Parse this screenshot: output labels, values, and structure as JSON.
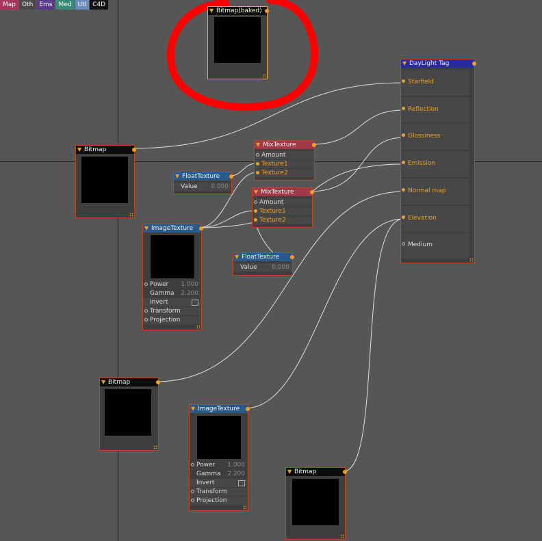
{
  "toolbar": {
    "tabs": [
      {
        "label": "Map",
        "color": "#a8365c"
      },
      {
        "label": "Oth",
        "color": "#4a4a4a"
      },
      {
        "label": "Ems",
        "color": "#5a3a8a"
      },
      {
        "label": "Med",
        "color": "#3a8a7a"
      },
      {
        "label": "Utl",
        "color": "#6a8ac0"
      },
      {
        "label": "C4D",
        "color": "#111111"
      }
    ]
  },
  "colors": {
    "bitmap_header": "#0c0c0c",
    "float_header": "#2a5a8a",
    "mix_header": "#a03a4a",
    "image_header": "#2a5a8a",
    "daylight_header": "#2a2aa0",
    "port": "#f0a020",
    "annotation": "#ff0000",
    "wire": "#e0e0e0"
  },
  "nodes": {
    "bitmap_baked": {
      "title": "Bitmap(baked)"
    },
    "bitmap1": {
      "title": "Bitmap"
    },
    "bitmap2": {
      "title": "Bitmap"
    },
    "bitmap3": {
      "title": "Bitmap"
    },
    "float1": {
      "title": "FloatTexture",
      "value_label": "Value",
      "value": "0.000"
    },
    "float2": {
      "title": "FloatTexture",
      "value_label": "Value",
      "value": "0.000"
    },
    "mix1": {
      "title": "MixTexture",
      "amount": "Amount",
      "tex1": "Texture1",
      "tex2": "Texture2"
    },
    "mix2": {
      "title": "MixTexture",
      "amount": "Amount",
      "tex1": "Texture1",
      "tex2": "Texture2"
    },
    "image1": {
      "title": "ImageTexture",
      "power_label": "Power",
      "power": "1.000",
      "gamma_label": "Gamma",
      "gamma": "2.200",
      "invert": "Invert",
      "transform": "Transform",
      "projection": "Projection"
    },
    "image2": {
      "title": "ImageTexture",
      "power_label": "Power",
      "power": "1.000",
      "gamma_label": "Gamma",
      "gamma": "2.200",
      "invert": "Invert",
      "transform": "Transform",
      "projection": "Projection"
    },
    "daylight": {
      "title": "DayLight Tag",
      "pins": [
        "Starfield",
        "Reflection",
        "Glossiness",
        "Emission",
        "Normal map",
        "Elevation",
        "Medium"
      ]
    }
  }
}
